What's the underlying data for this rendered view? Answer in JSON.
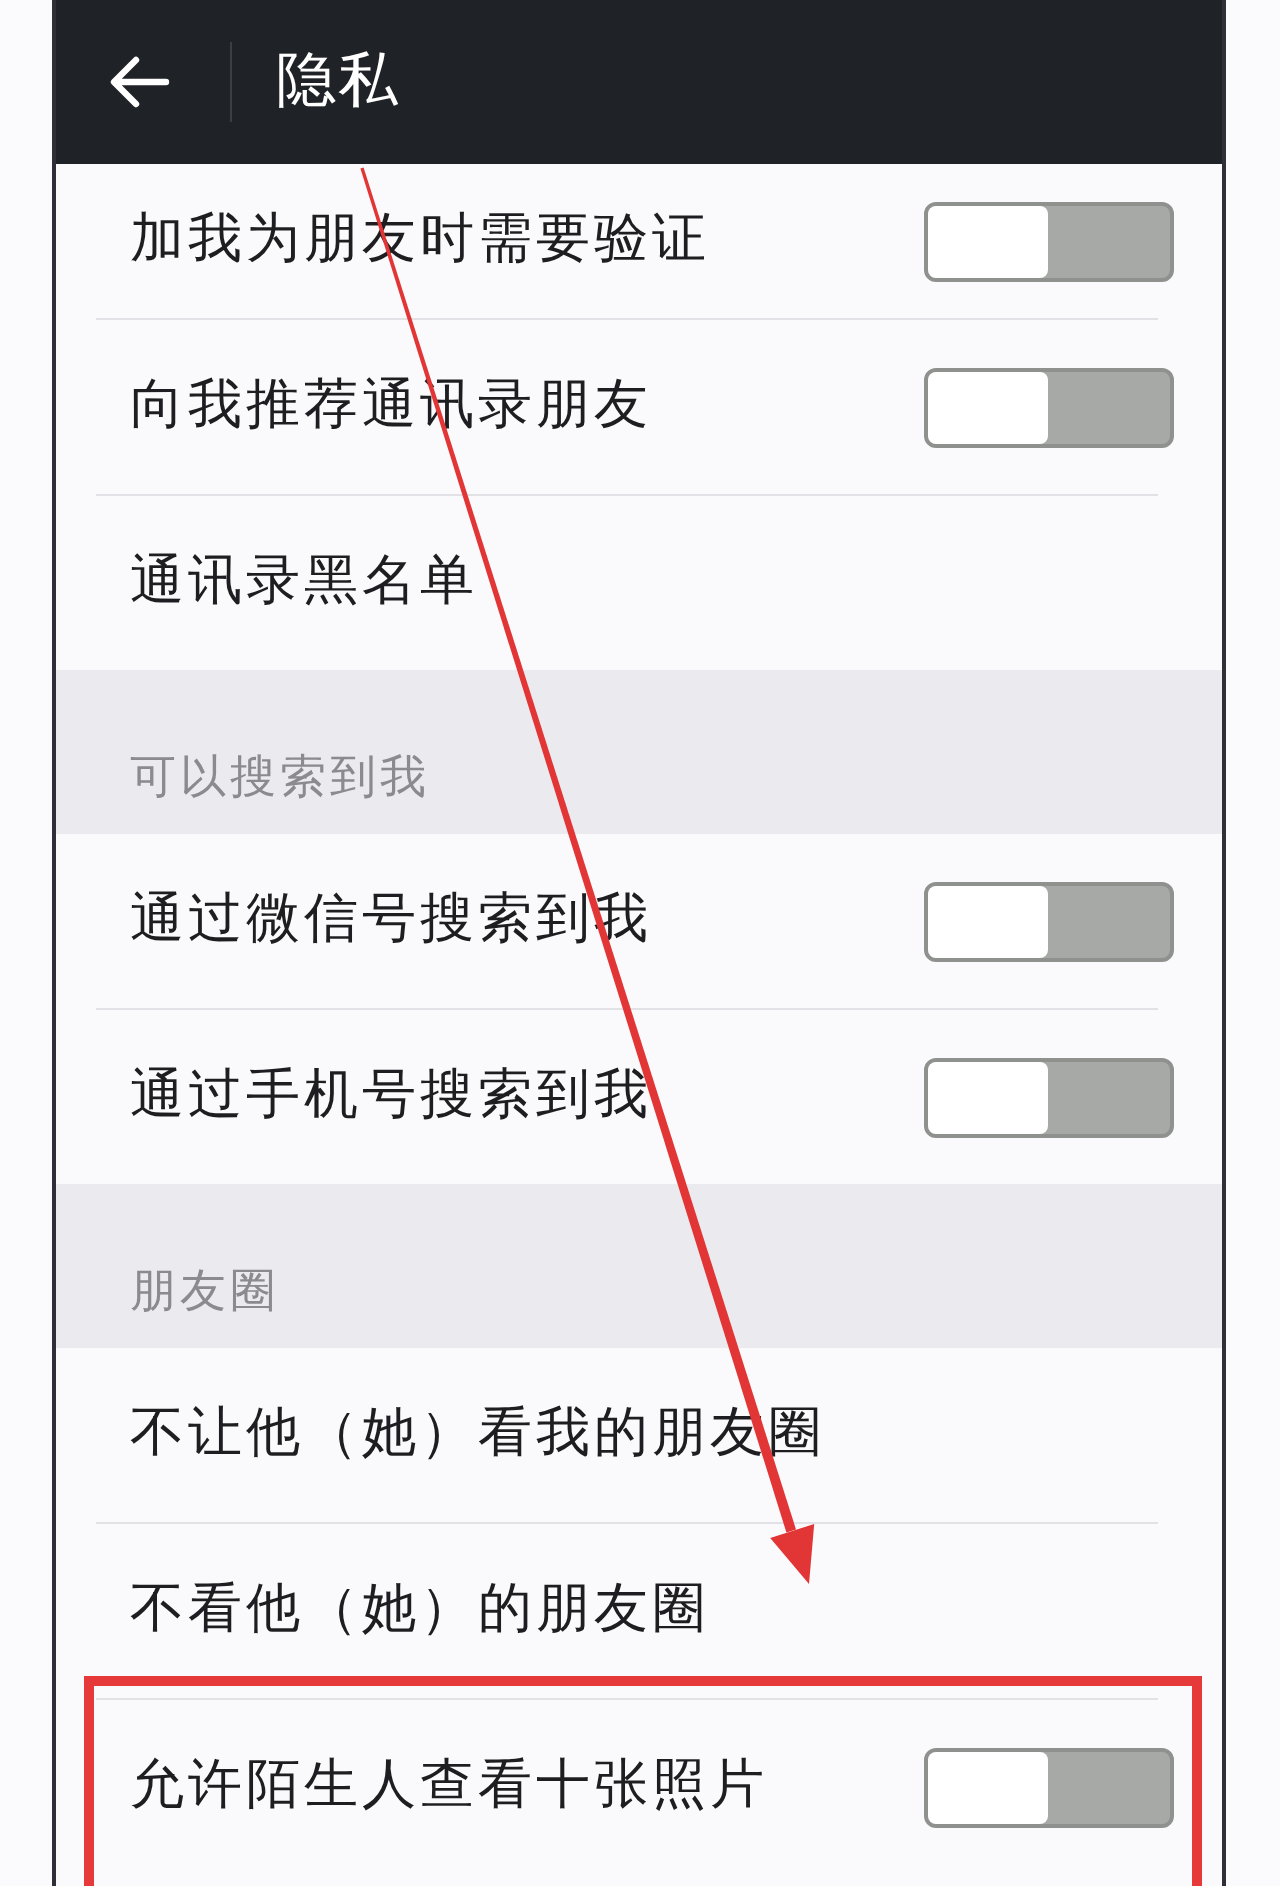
{
  "header": {
    "title": "隐私"
  },
  "sections": [
    {
      "items": [
        {
          "label": "加我为朋友时需要验证",
          "kind": "toggle",
          "checked": false,
          "highlighted": false
        },
        {
          "label": "向我推荐通讯录朋友",
          "kind": "toggle",
          "checked": false,
          "highlighted": false
        },
        {
          "label": "通讯录黑名单",
          "kind": "link",
          "highlighted": false
        }
      ]
    },
    {
      "title": "可以搜索到我",
      "items": [
        {
          "label": "通过微信号搜索到我",
          "kind": "toggle",
          "checked": false,
          "highlighted": false
        },
        {
          "label": "通过手机号搜索到我",
          "kind": "toggle",
          "checked": false,
          "highlighted": false
        }
      ]
    },
    {
      "title": "朋友圈",
      "items": [
        {
          "label": "不让他（她）看我的朋友圈",
          "kind": "link",
          "highlighted": false
        },
        {
          "label": "不看他（她）的朋友圈",
          "kind": "link",
          "highlighted": false
        },
        {
          "label": "允许陌生人查看十张照片",
          "kind": "toggle",
          "checked": false,
          "highlighted": true
        }
      ]
    }
  ]
}
